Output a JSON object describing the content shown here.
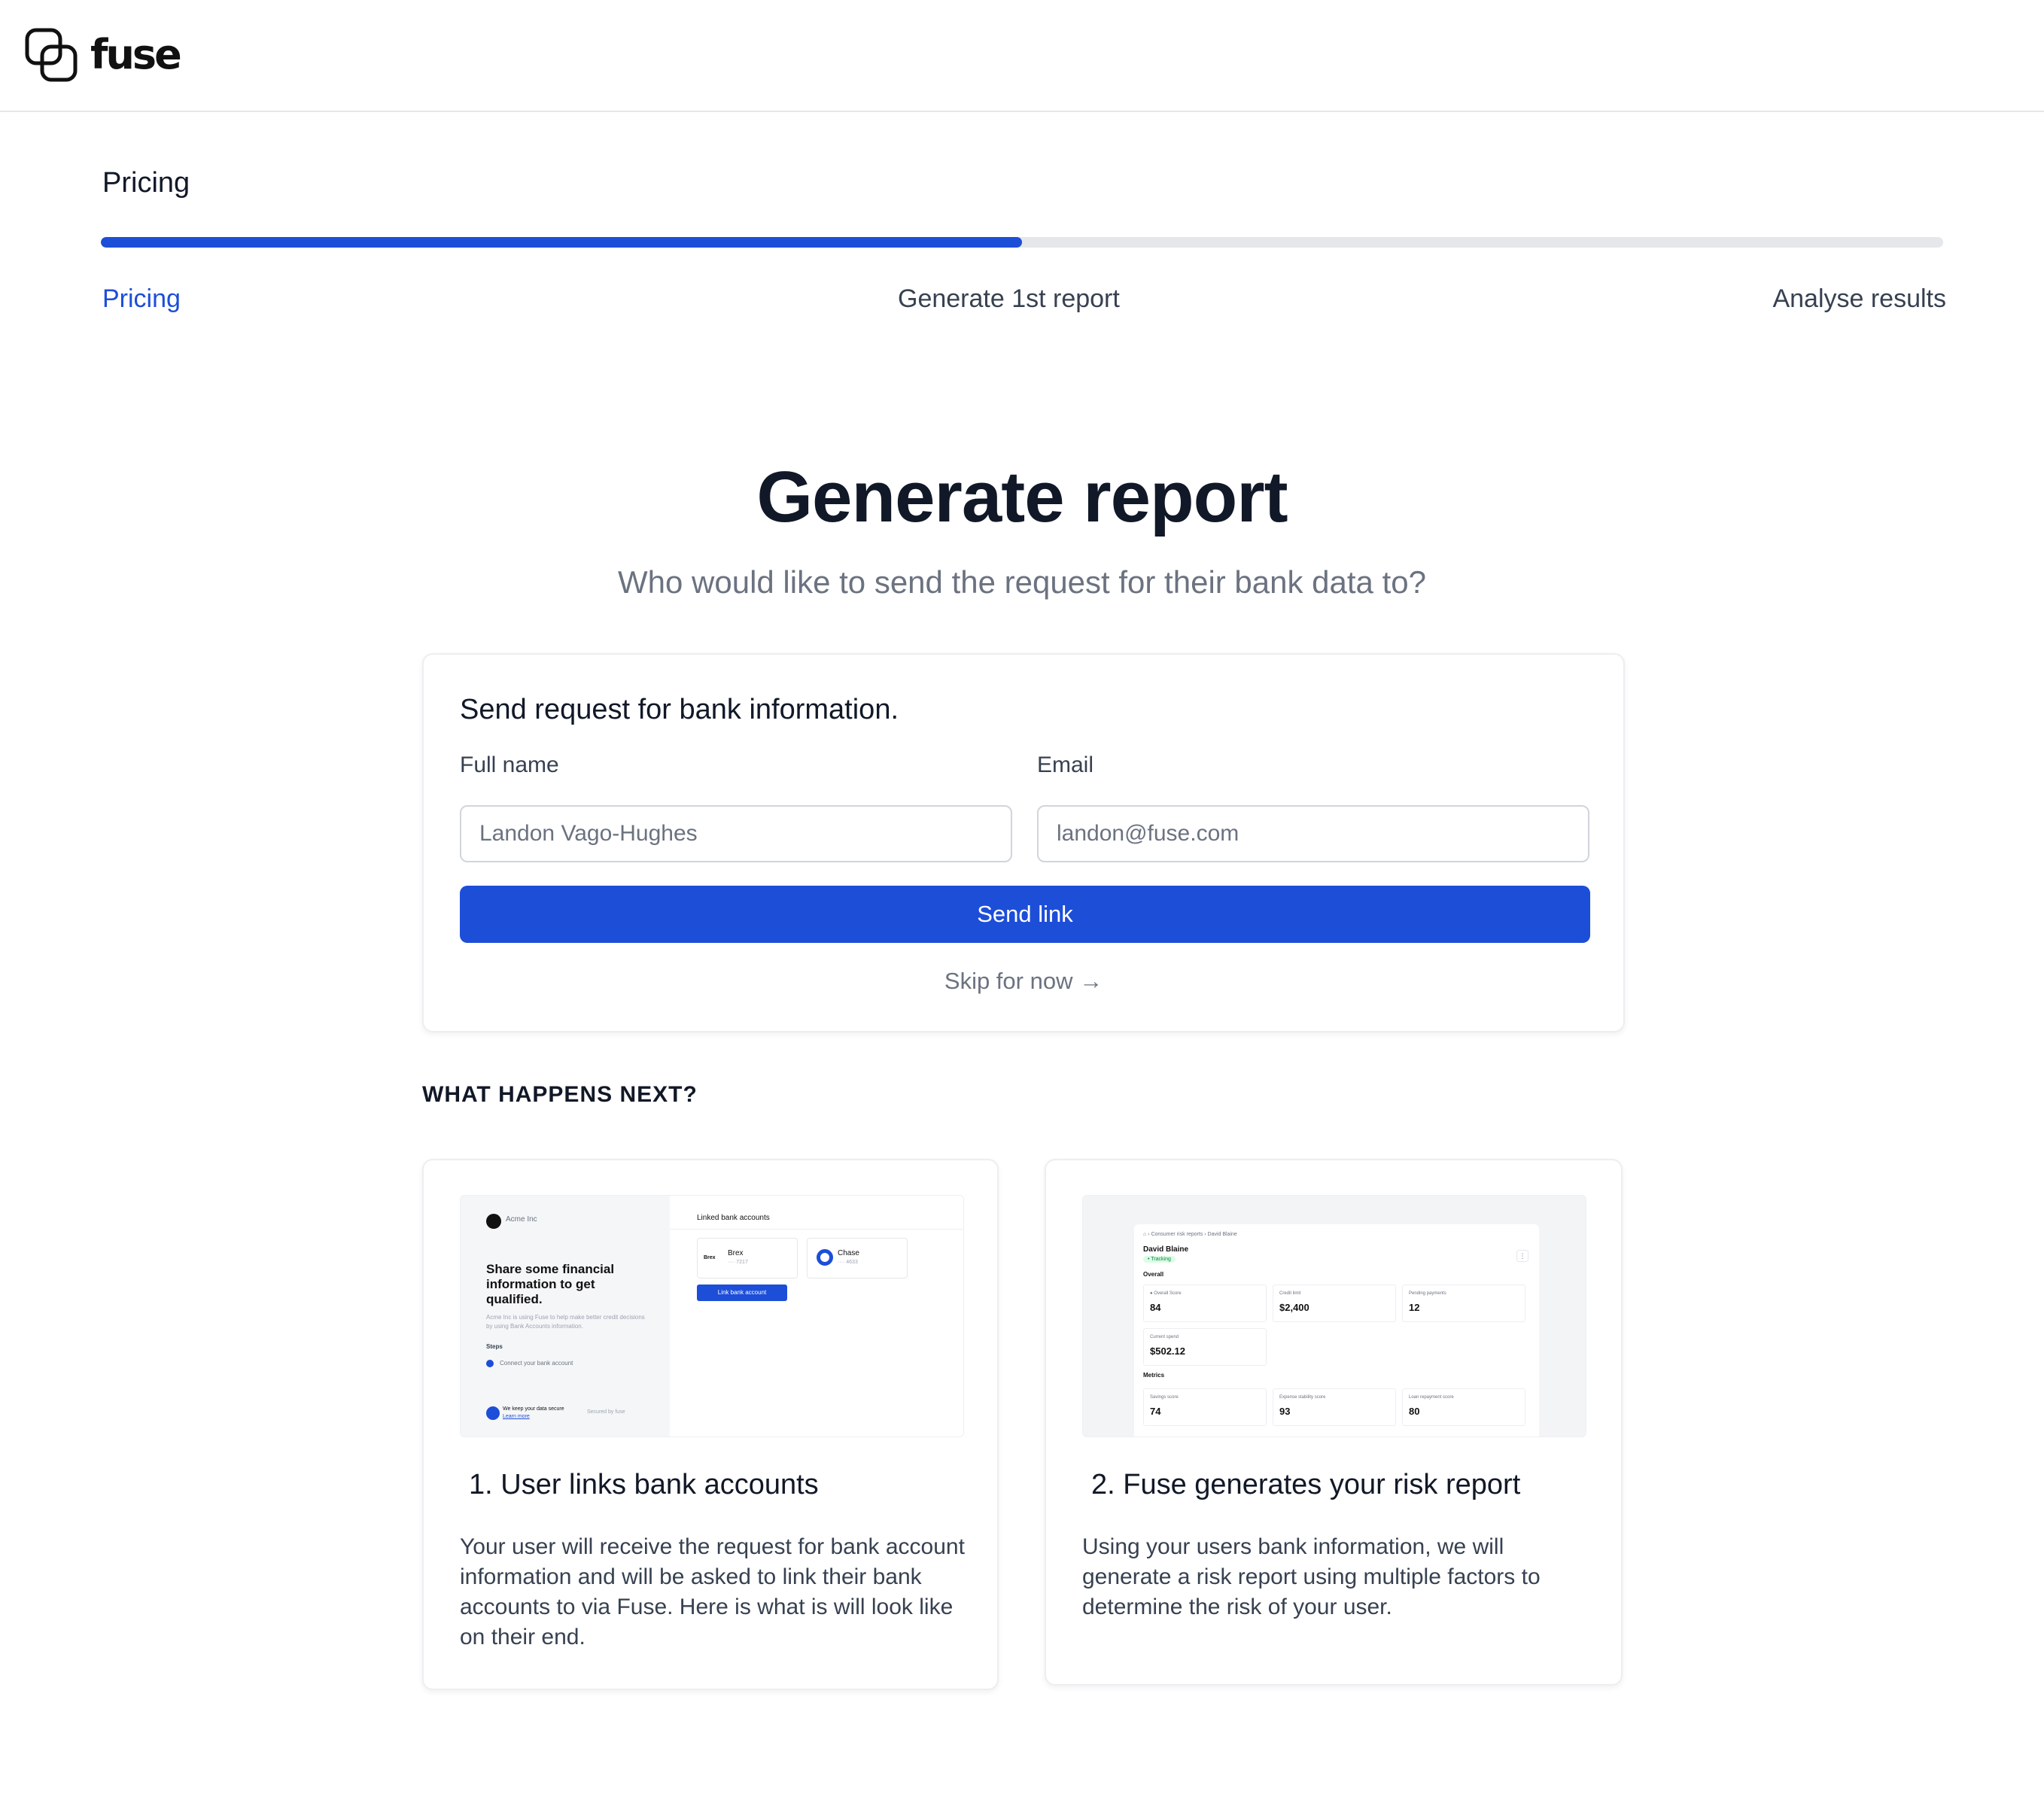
{
  "brand": {
    "name": "fuse"
  },
  "stepper": {
    "title": "Pricing",
    "progress_fraction": 0.5,
    "steps": [
      {
        "label": "Pricing",
        "state": "active"
      },
      {
        "label": "Generate 1st report",
        "state": "upcoming"
      },
      {
        "label": "Analyse results",
        "state": "upcoming"
      }
    ]
  },
  "hero": {
    "title": "Generate report",
    "subtitle": "Who would like to send the request for their bank data to?"
  },
  "form": {
    "heading": "Send request for bank information.",
    "full_name_label": "Full name",
    "full_name_placeholder": "Landon Vago-Hughes",
    "email_label": "Email",
    "email_placeholder": "landon@fuse.com",
    "send_button": "Send link",
    "skip_link": "Skip for now →"
  },
  "next": {
    "heading": "WHAT HAPPENS NEXT?",
    "cards": [
      {
        "title": "1. User links bank accounts",
        "description": "Your user will receive the request for bank account information and will be asked to link their bank accounts to via Fuse. Here is what is will look like on their end.",
        "preview": {
          "company": "Acme Inc",
          "headline": "Share some financial information to get qualified.",
          "body": "Acme Inc is using Fuse to help make better credit decisions by using Bank Accounts information.",
          "steps_label": "Steps",
          "step_item": "Connect your bank account",
          "secure_text": "We keep your data secure",
          "learn_more": "Learn more",
          "powered_by": "Secured by fuse",
          "linked_title": "Linked bank accounts",
          "banks": [
            {
              "name": "Brex",
              "logo": "Brex",
              "mask": "···· 7217"
            },
            {
              "name": "Chase",
              "mask": "···· 4633"
            }
          ],
          "link_button": "Link bank account"
        }
      },
      {
        "title": "2. Fuse generates your risk report",
        "description": "Using your users bank information, we will generate a risk report using multiple factors to determine the risk of your user.",
        "preview": {
          "breadcrumb": "⌂  ›  Consumer risk reports  ›  David Blaine",
          "person": "David Blaine",
          "badge": "• Tracking",
          "more": "⋮",
          "overall_label": "Overall",
          "metrics_label": "Metrics",
          "overall": [
            {
              "label": "● Overall Score",
              "value": "84"
            },
            {
              "label": "Credit limit",
              "value": "$2,400"
            },
            {
              "label": "Pending payments",
              "value": "12"
            },
            {
              "label": "Current spend",
              "value": "$502.12"
            }
          ],
          "metrics": [
            {
              "label": "Savings score",
              "value": "74"
            },
            {
              "label": "Expense stability score",
              "value": "93"
            },
            {
              "label": "Loan repayment score",
              "value": "80"
            }
          ]
        }
      }
    ]
  },
  "colors": {
    "accent": "#1d4ed8",
    "track": "#e5e7eb",
    "text": "#111827",
    "muted": "#6b7280"
  }
}
